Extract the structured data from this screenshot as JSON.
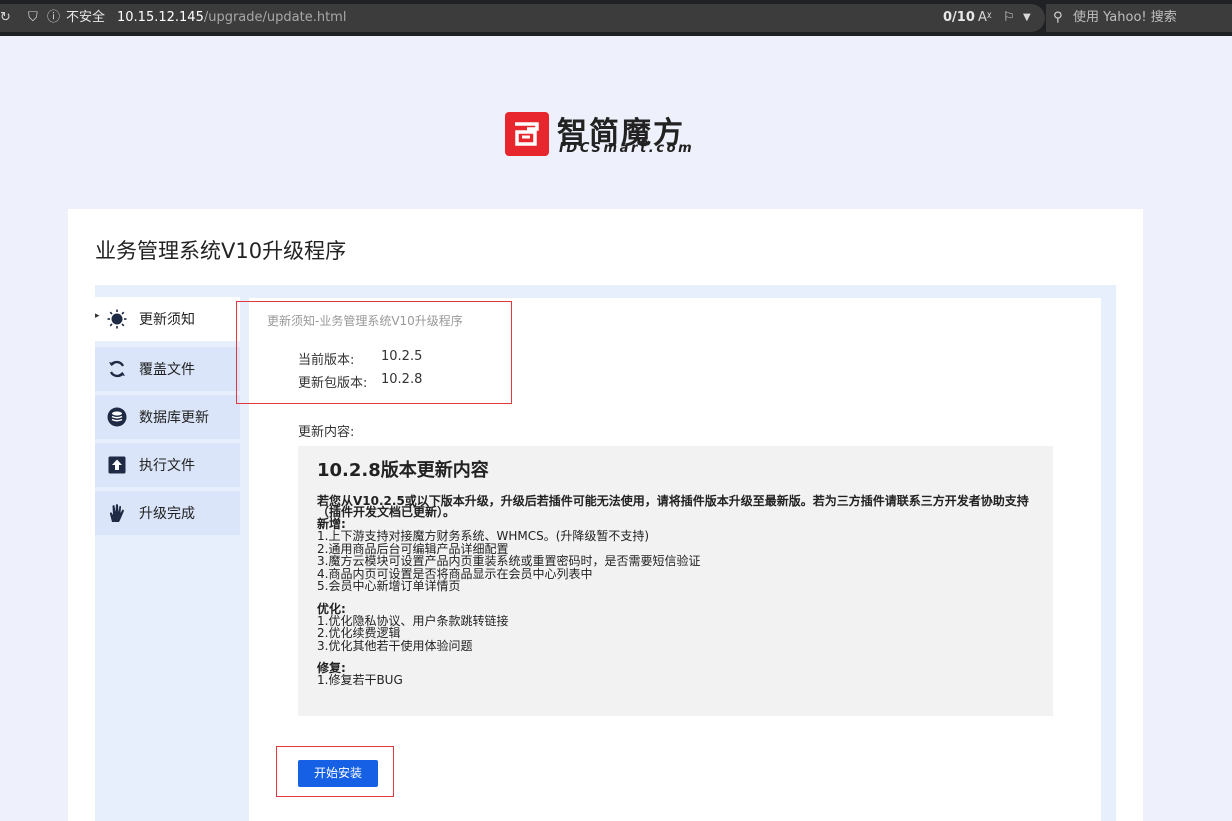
{
  "browser": {
    "security_label": "不安全",
    "url_host": "10.15.12.145",
    "url_path": "/upgrade/update.html",
    "counter": "0/10",
    "search_placeholder": "使用 Yahoo! 搜索"
  },
  "logo": {
    "name_cn": "智简魔方",
    "name_en": "IDCSmart.com"
  },
  "page": {
    "title": "业务管理系统V10升级程序"
  },
  "steps": [
    {
      "label": "更新须知",
      "icon": "lightbulb-icon",
      "active": true
    },
    {
      "label": "覆盖文件",
      "icon": "refresh-icon",
      "active": false
    },
    {
      "label": "数据库更新",
      "icon": "database-icon",
      "active": false
    },
    {
      "label": "执行文件",
      "icon": "upload-icon",
      "active": false
    },
    {
      "label": "升级完成",
      "icon": "hand-icon",
      "active": false
    }
  ],
  "notice": {
    "heading": "更新须知-业务管理系统V10升级程序",
    "current_version_label": "当前版本:",
    "current_version": "10.2.5",
    "package_version_label": "更新包版本:",
    "package_version": "10.2.8",
    "content_label": "更新内容:"
  },
  "release": {
    "title": "10.2.8版本更新内容",
    "warning": "若您从V10.2.5或以下版本升级，升级后若插件可能无法使用，请将插件版本升级至最新版。若为三方插件请联系三方开发者协助支持（插件开发文档已更新）。",
    "sections": [
      {
        "heading": "新增:",
        "items": [
          "1.上下游支持对接魔方财务系统、WHMCS。(升降级暂不支持)",
          "2.通用商品后台可编辑产品详细配置",
          "3.魔方云模块可设置产品内页重装系统或重置密码时，是否需要短信验证",
          "4.商品内页可设置是否将商品显示在会员中心列表中",
          "5.会员中心新增订单详情页"
        ]
      },
      {
        "heading": "优化:",
        "items": [
          "1.优化隐私协议、用户条款跳转链接",
          "2.优化续费逻辑",
          "3.优化其他若干使用体验问题"
        ]
      },
      {
        "heading": "修复:",
        "items": [
          "1.修复若干BUG"
        ]
      }
    ]
  },
  "actions": {
    "start_install": "开始安装"
  },
  "colors": {
    "accent": "#1660e6",
    "brand_red": "#e8262d",
    "highlight": "#e0383e",
    "panel_bg": "#e7eefc"
  }
}
